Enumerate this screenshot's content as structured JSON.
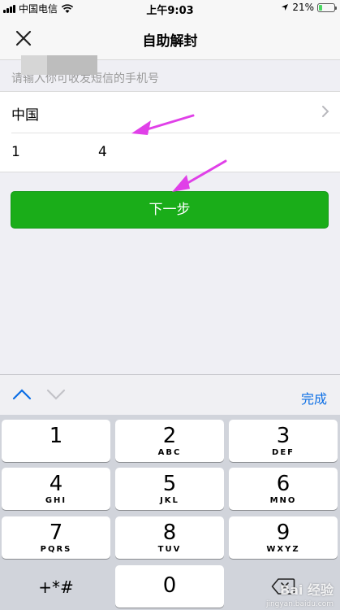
{
  "status_bar": {
    "carrier": "中国电信",
    "time": "上午9:03",
    "battery": "21%",
    "battery_level": 0.21,
    "icons": [
      "signal-icon",
      "wifi-icon",
      "location-icon",
      "battery-icon"
    ]
  },
  "nav": {
    "title": "自助解封",
    "close_icon": "close-icon"
  },
  "form": {
    "hint": "请输入你可收发短信的手机号",
    "country": "中国",
    "phone_prefix": "1",
    "phone_suffix": "4"
  },
  "next_button": {
    "label": "下一步"
  },
  "accent_colors": {
    "primary_green": "#1aad19",
    "link_blue": "#0b6ee5",
    "annotation": "#e040e8"
  },
  "keyboard_toolbar": {
    "done_label": "完成"
  },
  "keypad": {
    "keys": [
      {
        "num": "1",
        "letters": ""
      },
      {
        "num": "2",
        "letters": "ABC"
      },
      {
        "num": "3",
        "letters": "DEF"
      },
      {
        "num": "4",
        "letters": "GHI"
      },
      {
        "num": "5",
        "letters": "JKL"
      },
      {
        "num": "6",
        "letters": "MNO"
      },
      {
        "num": "7",
        "letters": "PQRS"
      },
      {
        "num": "8",
        "letters": "TUV"
      },
      {
        "num": "9",
        "letters": "WXYZ"
      },
      {
        "num": "+*#",
        "letters": ""
      },
      {
        "num": "0",
        "letters": ""
      }
    ]
  },
  "watermark": {
    "text": "Bai 经验",
    "sub": "jingyan.baidu.com"
  }
}
